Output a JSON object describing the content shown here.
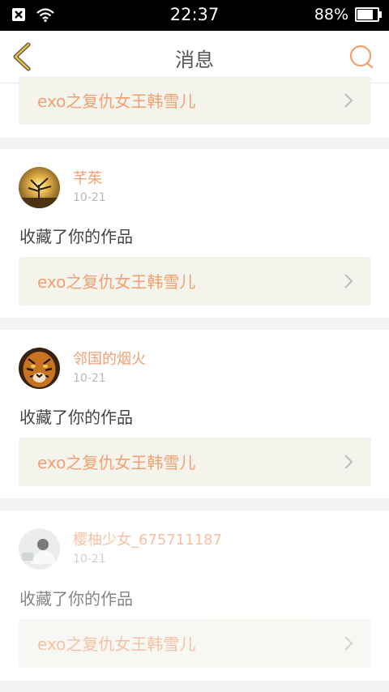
{
  "status_bar": {
    "time": "22:37",
    "battery": "88%",
    "battery_level": 0.88
  },
  "header": {
    "title": "消息",
    "back_icon": "chevron-left-icon",
    "search_icon": "search-icon"
  },
  "colors": {
    "accent": "#f0a071",
    "back_icon": "#e8c33a"
  },
  "messages": [
    {
      "work_title": "exo之复仇女王韩雪儿"
    },
    {
      "username": "芊茱",
      "date": "10-21",
      "action": "收藏了你的作品",
      "work_title": "exo之复仇女王韩雪儿"
    },
    {
      "username": "邻国的烟火",
      "date": "10-21",
      "action": "收藏了你的作品",
      "work_title": "exo之复仇女王韩雪儿"
    },
    {
      "username": "樱柚少女_675711187",
      "date": "10-21",
      "action": "收藏了你的作品",
      "work_title": "exo之复仇女王韩雪儿"
    }
  ]
}
